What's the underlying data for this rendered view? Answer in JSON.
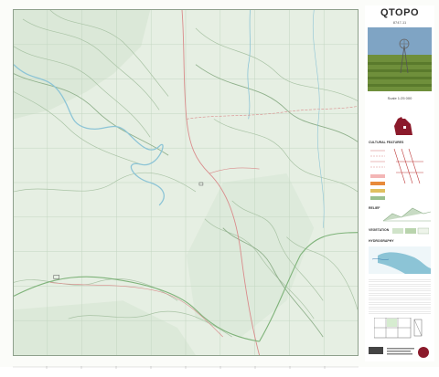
{
  "map": {
    "title": "QTOPO",
    "sheet_number": "8747-11",
    "scale_text": "Scale 1:25 000",
    "headings": {
      "cultural": "CULTURAL FEATURES",
      "relief": "RELIEF",
      "vegetation": "VEGETATION",
      "hydrography": "HYDROGRAPHY"
    },
    "colors": {
      "terrain": "#e4eee2",
      "contour": "#b9cfb6",
      "river": "#8cc4d6",
      "road": "#d98b8b",
      "boundary": "#7fb37a",
      "state_highlight": "#8b1a2b"
    }
  }
}
